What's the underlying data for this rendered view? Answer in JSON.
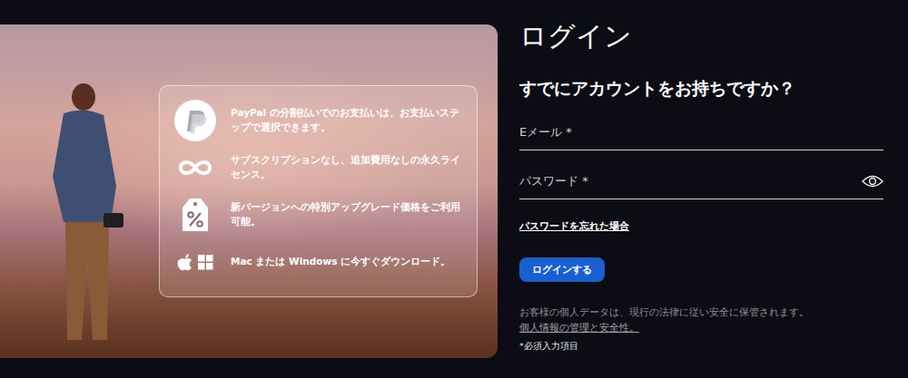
{
  "promo": {
    "features": [
      {
        "kind": "paypal",
        "text": "PayPal の分割払いでのお支払いは、お支払いステップで選択できます。"
      },
      {
        "kind": "infinity",
        "text": "サブスクリプションなし、追加費用なしの永久ライセンス。"
      },
      {
        "kind": "tag",
        "text": "新バージョンへの特別アップグレード価格をご利用可能。"
      },
      {
        "kind": "platforms",
        "text": "Mac または Windows に今すぐダウンロード。"
      }
    ]
  },
  "login": {
    "title": "ログイン",
    "subtitle": "すでにアカウントをお持ちですか？",
    "email": {
      "placeholder": "Eメール *"
    },
    "password": {
      "placeholder": "パスワード *"
    },
    "forgot": "パスワードを忘れた場合",
    "submit": "ログインする",
    "privacy_note": "お客様の個人データは、現行の法律に従い安全に保管されます。",
    "privacy_link": "個人情報の管理と安全性。",
    "required_note": "*必須入力項目"
  }
}
